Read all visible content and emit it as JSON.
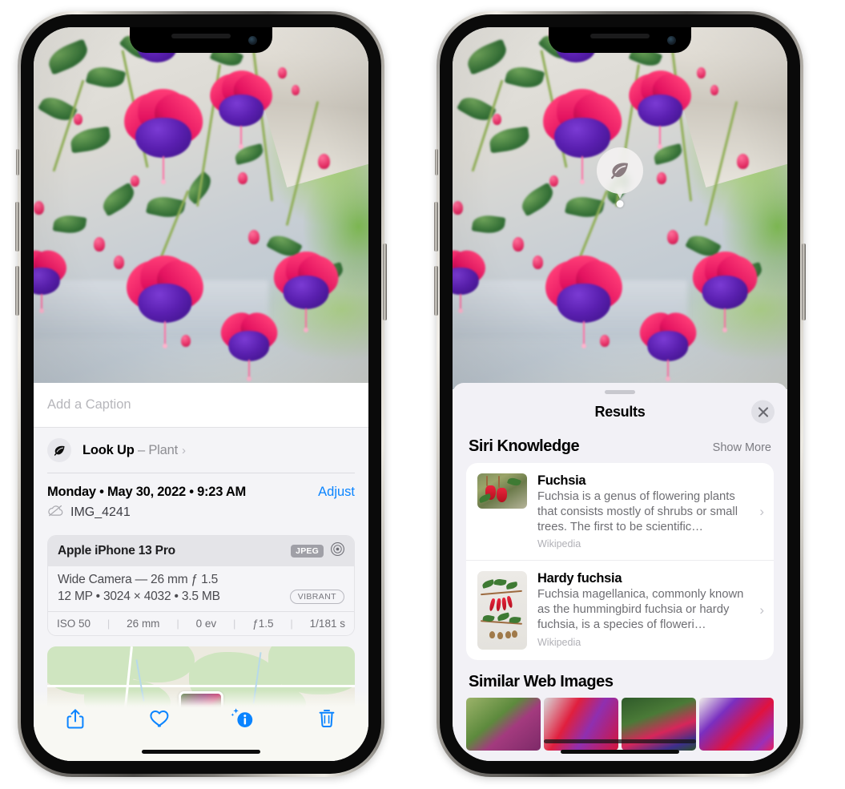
{
  "left_phone": {
    "name": "iPhone photo detail view",
    "caption_field": {
      "placeholder": "Add a Caption",
      "value": ""
    },
    "lookup_row": {
      "icon": "leaf-icon",
      "label": "Look Up",
      "dash": " – ",
      "subject": "Plant",
      "chevron": "chevron-right-icon"
    },
    "date_row": {
      "date_text": "Monday • May 30, 2022 • 9:23 AM",
      "adjust_label": "Adjust",
      "cloud_icon": "cloud-slash-icon",
      "file_name": "IMG_4241"
    },
    "exif": {
      "device": "Apple iPhone 13 Pro",
      "format_badge": "JPEG",
      "lens_icon": "aperture-icon",
      "lens_line": "Wide Camera — 26 mm ƒ 1.5",
      "specs_line": "12 MP • 3024 × 4032 • 3.5 MB",
      "style_badge": "VIBRANT",
      "stats": [
        "ISO 50",
        "26 mm",
        "0 ev",
        "ƒ1.5",
        "1/181 s"
      ]
    },
    "toolbar": {
      "share": "share-icon",
      "favorite": "heart-icon",
      "info": "info-sparkle-icon",
      "delete": "trash-icon"
    }
  },
  "right_phone": {
    "name": "Visual Look Up results sheet",
    "visual_lookup_badge": {
      "icon": "leaf-icon"
    },
    "sheet": {
      "title": "Results",
      "close_icon": "close-icon",
      "grabber": "drag-handle"
    },
    "siri_knowledge": {
      "heading": "Siri Knowledge",
      "action": "Show More",
      "items": [
        {
          "title": "Fuchsia",
          "description": "Fuchsia is a genus of flowering plants that consists mostly of shrubs or small trees. The first to be scientific…",
          "source": "Wikipedia",
          "thumb": "fuchsia-flowers-thumbnail",
          "chevron": "chevron-right-icon"
        },
        {
          "title": "Hardy fuchsia",
          "description": "Fuchsia magellanica, commonly known as the hummingbird fuchsia or hardy fuchsia, is a species of floweri…",
          "source": "Wikipedia",
          "thumb": "hardy-fuchsia-specimen-thumbnail",
          "chevron": "chevron-right-icon"
        }
      ]
    },
    "similar_web_images": {
      "heading": "Similar Web Images",
      "thumbs": [
        "fuchsia-magenta-bloom",
        "fuchsia-red-closeup",
        "fuchsia-shrub-buds",
        "fuchsia-purple-double"
      ]
    }
  },
  "colors": {
    "accent_blue": "#0a84ff",
    "sheet_bg": "#f2f1f6",
    "panel_bg": "#f4f4f7",
    "card_bg": "#ffffff",
    "secondary_text": "#8e8e93",
    "tertiary_text": "#b0b0b6"
  }
}
